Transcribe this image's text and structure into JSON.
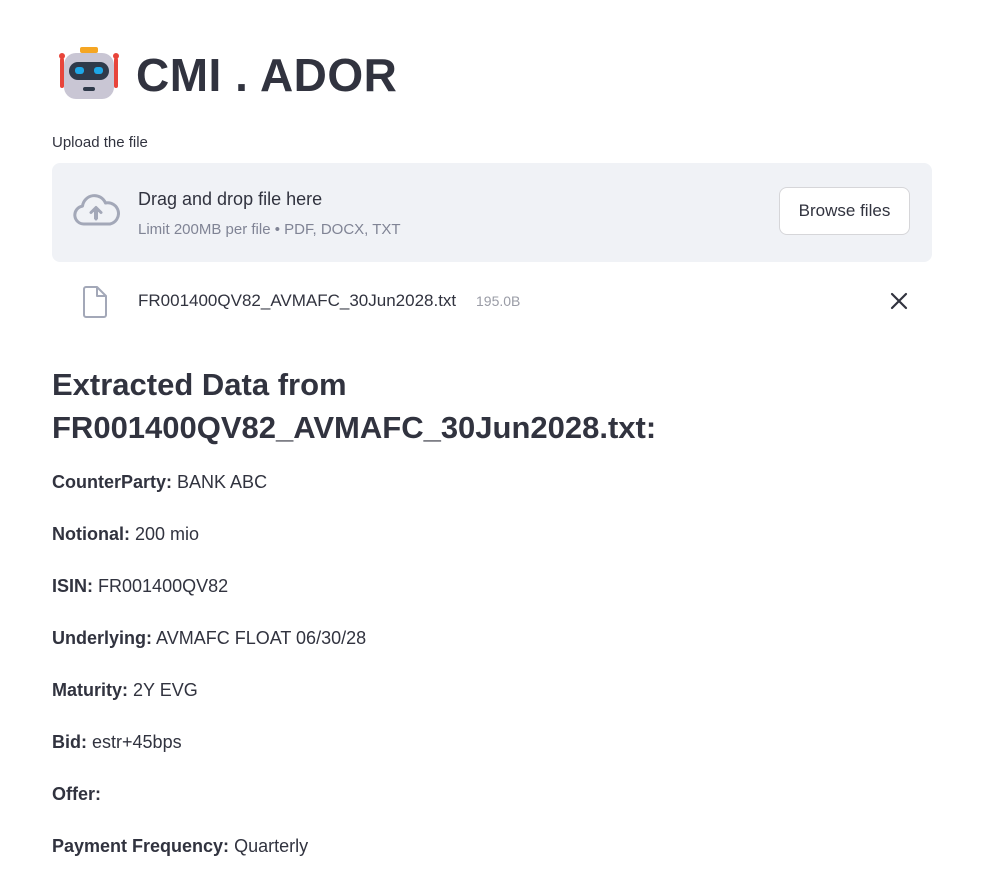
{
  "app": {
    "title": "CMI . ADOR",
    "logo_icon": "robot-icon"
  },
  "uploader": {
    "label": "Upload the file",
    "drop_title": "Drag and drop file here",
    "drop_subtitle": "Limit 200MB per file • PDF, DOCX, TXT",
    "browse_label": "Browse files",
    "upload_icon": "cloud-upload-icon"
  },
  "uploaded_file": {
    "name": "FR001400QV82_AVMAFC_30Jun2028.txt",
    "size": "195.0B",
    "file_icon": "file-icon",
    "remove_icon": "close-icon"
  },
  "extracted": {
    "heading_line1": "Extracted Data from",
    "heading_line2": "FR001400QV82_AVMAFC_30Jun2028.txt:",
    "fields": [
      {
        "label": "CounterParty:",
        "value": "BANK ABC"
      },
      {
        "label": "Notional:",
        "value": "200 mio"
      },
      {
        "label": "ISIN:",
        "value": "FR001400QV82"
      },
      {
        "label": "Underlying:",
        "value": "AVMAFC FLOAT 06/30/28"
      },
      {
        "label": "Maturity:",
        "value": "2Y EVG"
      },
      {
        "label": "Bid:",
        "value": "estr+45bps"
      },
      {
        "label": "Offer:",
        "value": ""
      },
      {
        "label": "Payment Frequency:",
        "value": "Quarterly"
      }
    ]
  },
  "colors": {
    "text": "#31333f",
    "muted": "#808495",
    "dropzone_bg": "#f0f2f6",
    "robot_accent": "#e8443a",
    "robot_eyes": "#1ea7e6",
    "robot_antenna": "#f5a623"
  }
}
